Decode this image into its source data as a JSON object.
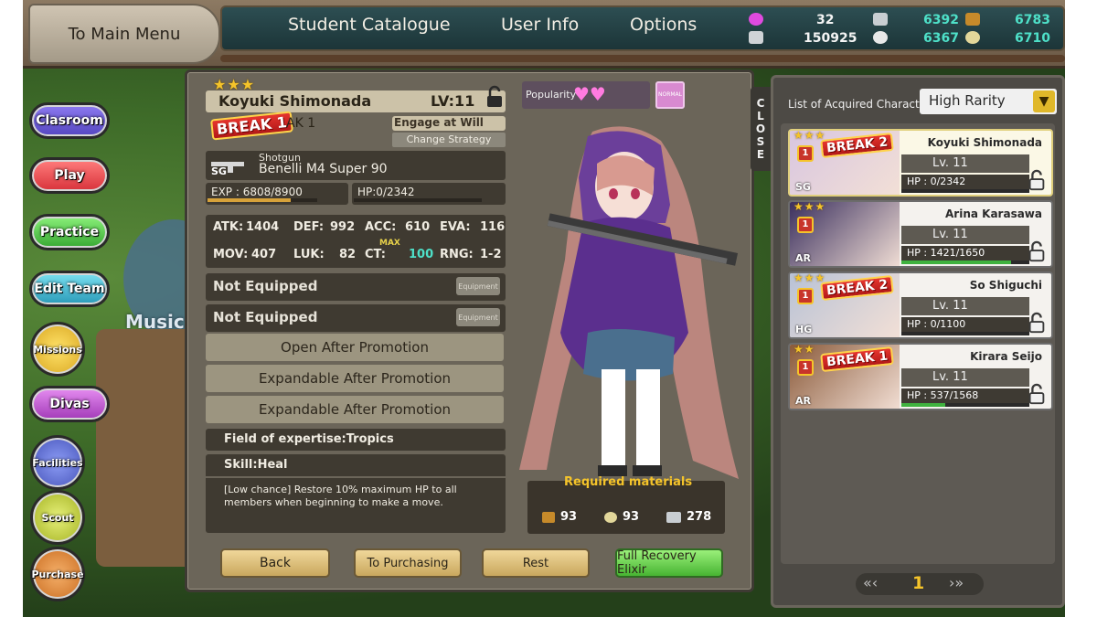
{
  "topbar": {
    "main_menu_label": "To Main Menu",
    "tabs": [
      "Student Catalogue",
      "User Info",
      "Options"
    ],
    "resources": {
      "hearts": "32",
      "credits": "150925",
      "res_a": "6392",
      "res_b": "6783",
      "res_c": "6367",
      "res_d": "6710"
    }
  },
  "side_menu": [
    "Clasroom",
    "Play",
    "Practice",
    "Edit Team",
    "Missions",
    "Divas",
    "Facilities",
    "Scout",
    "Purchase"
  ],
  "background_text": "Music",
  "character": {
    "stars": "★★★",
    "name": "Koyuki Shimonada",
    "level": "LV:11",
    "break_badge": "BREAK 1",
    "break_label": "AK 1",
    "engage": "Engage at Will",
    "change_strategy": "Change Strategy",
    "weapon_type": "Shotgun",
    "weapon_class": "SG",
    "weapon_name": "Benelli M4 Super 90",
    "exp": "EXP : 6808/8900",
    "exp_fraction": 0.76,
    "hp": "HP:0/2342",
    "hp_fraction": 0.0,
    "stats": {
      "atk_label": "ATK:",
      "atk": "1404",
      "def_label": "DEF:",
      "def": "992",
      "acc_label": "ACC:",
      "acc": "610",
      "eva_label": "EVA:",
      "eva": "116",
      "mov_label": "MOV:",
      "mov": "407",
      "luk_label": "LUK:",
      "luk": "82",
      "ct_label": "CT:",
      "ct": "100",
      "ct_max": "MAX",
      "rng_label": "RNG:",
      "rng": "1-2"
    },
    "popularity_label": "Popularity",
    "popularity_hearts": "♥♥",
    "popularity_badge": "NORMAL",
    "equip_slots": [
      "Not Equipped",
      "Not Equipped"
    ],
    "equip_button": "Equipment",
    "promotion_slots": [
      "Open After Promotion",
      "Expandable After Promotion",
      "Expandable After Promotion"
    ],
    "field": "Field of expertise:Tropics",
    "skill": "Skill:Heal",
    "skill_desc": "[Low chance] Restore 10% maximum HP to all members when beginning to make a move.",
    "required_label": "Required materials",
    "materials": [
      "93",
      "93",
      "278"
    ]
  },
  "buttons": {
    "back": "Back",
    "purchasing": "To Purchasing",
    "rest": "Rest",
    "elixir": "Full Recovery Elixir"
  },
  "list": {
    "close_label": "CLOSE",
    "header": "List of Acquired Characters",
    "sort": "High Rarity",
    "page": "1",
    "cards": [
      {
        "name": "Koyuki Shimonada",
        "lv": "Lv. 11",
        "hp": "HP : 0/2342",
        "hp_fraction": 0.0,
        "stars": "★★★",
        "break": "BREAK 2",
        "weapon": "SG",
        "rank": "1"
      },
      {
        "name": "Arina Karasawa",
        "lv": "Lv. 11",
        "hp": "HP : 1421/1650",
        "hp_fraction": 0.86,
        "stars": "★★★",
        "break": "",
        "weapon": "AR",
        "rank": "1"
      },
      {
        "name": "So Shiguchi",
        "lv": "Lv. 11",
        "hp": "HP : 0/1100",
        "hp_fraction": 0.0,
        "stars": "★★★",
        "break": "BREAK 2",
        "weapon": "HG",
        "rank": "1"
      },
      {
        "name": "Kirara Seijo",
        "lv": "Lv. 11",
        "hp": "HP : 537/1568",
        "hp_fraction": 0.34,
        "stars": "★★",
        "break": "BREAK 1",
        "weapon": "AR",
        "rank": "1"
      }
    ]
  },
  "colors": {
    "accent_teal": "#4ee0c8",
    "exp_bar": "#d7a23a",
    "hp_bar": "#3fb23f",
    "break_red": "#d62a22"
  }
}
